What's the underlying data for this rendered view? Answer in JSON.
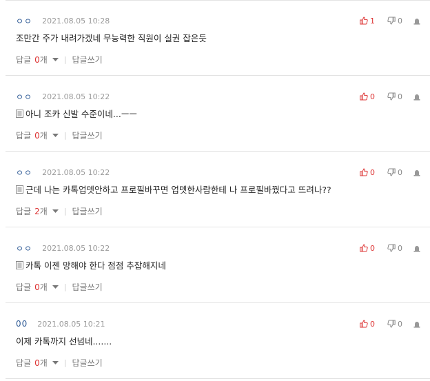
{
  "comments": [
    {
      "author": "ㅇㅇ",
      "date": "2021.08.05 10:28",
      "text": "조만간 주가 내려가겠네 무능력한 직원이 실권 잡은듯",
      "mobile": false,
      "likes": "1",
      "dislikes": "0",
      "reply_label": "답글",
      "reply_count": "0",
      "reply_unit": "개",
      "write_label": "답글쓰기"
    },
    {
      "author": "ㅇㅇ",
      "date": "2021.08.05 10:22",
      "text": "아니 조카 신발 수준이네...ㅡㅡ",
      "mobile": true,
      "likes": "0",
      "dislikes": "0",
      "reply_label": "답글",
      "reply_count": "0",
      "reply_unit": "개",
      "write_label": "답글쓰기"
    },
    {
      "author": "ㅇㅇ",
      "date": "2021.08.05 10:22",
      "text": "근데 나는 카톡업뎃안하고 프로필바꾸면 업뎃한사람한테 나 프로필바꿨다고 뜨려나??",
      "mobile": true,
      "likes": "0",
      "dislikes": "0",
      "reply_label": "답글",
      "reply_count": "2",
      "reply_unit": "개",
      "write_label": "답글쓰기"
    },
    {
      "author": "ㅇㅇ",
      "date": "2021.08.05 10:22",
      "text": "카톡 이젠 망해야 한다 점점 추잡해지네",
      "mobile": true,
      "likes": "0",
      "dislikes": "0",
      "reply_label": "답글",
      "reply_count": "0",
      "reply_unit": "개",
      "write_label": "답글쓰기"
    },
    {
      "author": "00",
      "date": "2021.08.05 10:21",
      "text": "이제 카톡까지 선넘네.......",
      "mobile": false,
      "likes": "0",
      "dislikes": "0",
      "reply_label": "답글",
      "reply_count": "0",
      "reply_unit": "개",
      "write_label": "답글쓰기"
    }
  ],
  "colors": {
    "author": "#2f5b96",
    "accent_red": "#dd3333",
    "muted": "#777777",
    "divider": "#e3e3e3"
  },
  "icons": {
    "like": "thumbs-up-icon",
    "dislike": "thumbs-down-icon",
    "report": "siren-icon",
    "mobile": "mobile-icon",
    "caret": "caret-down-icon"
  }
}
